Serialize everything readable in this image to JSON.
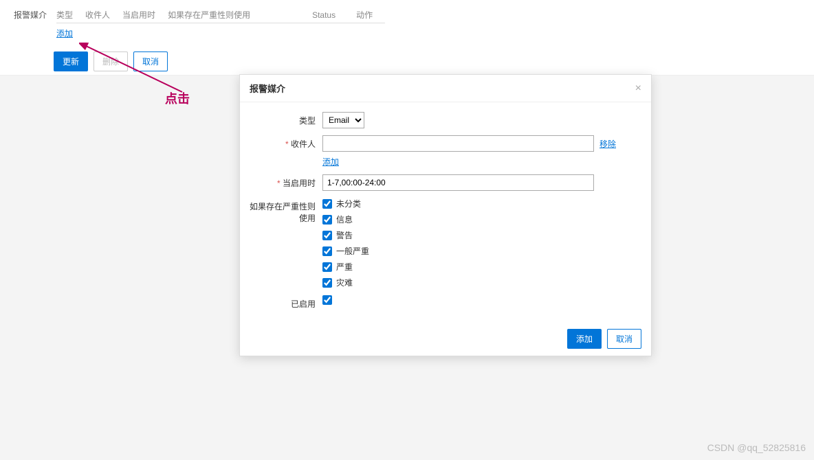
{
  "top": {
    "section_label": "报警媒介",
    "headers": [
      "类型",
      "收件人",
      "当启用时",
      "如果存在严重性则使用",
      "Status",
      "动作"
    ],
    "add_link": "添加",
    "buttons": {
      "update": "更新",
      "delete": "删除",
      "cancel": "取消"
    }
  },
  "annotation": {
    "label": "点击"
  },
  "modal": {
    "title": "报警媒介",
    "fields": {
      "type_label": "类型",
      "type_value": "Email",
      "recipient_label": "收件人",
      "recipient_value": "",
      "remove_link": "移除",
      "add_link": "添加",
      "when_label": "当启用时",
      "when_value": "1-7,00:00-24:00",
      "severity_label": "如果存在严重性则使用",
      "severities": [
        "未分类",
        "信息",
        "警告",
        "一般严重",
        "严重",
        "灾难"
      ],
      "enabled_label": "已启用"
    },
    "buttons": {
      "add": "添加",
      "cancel": "取消"
    }
  },
  "watermark": "CSDN @qq_52825816"
}
